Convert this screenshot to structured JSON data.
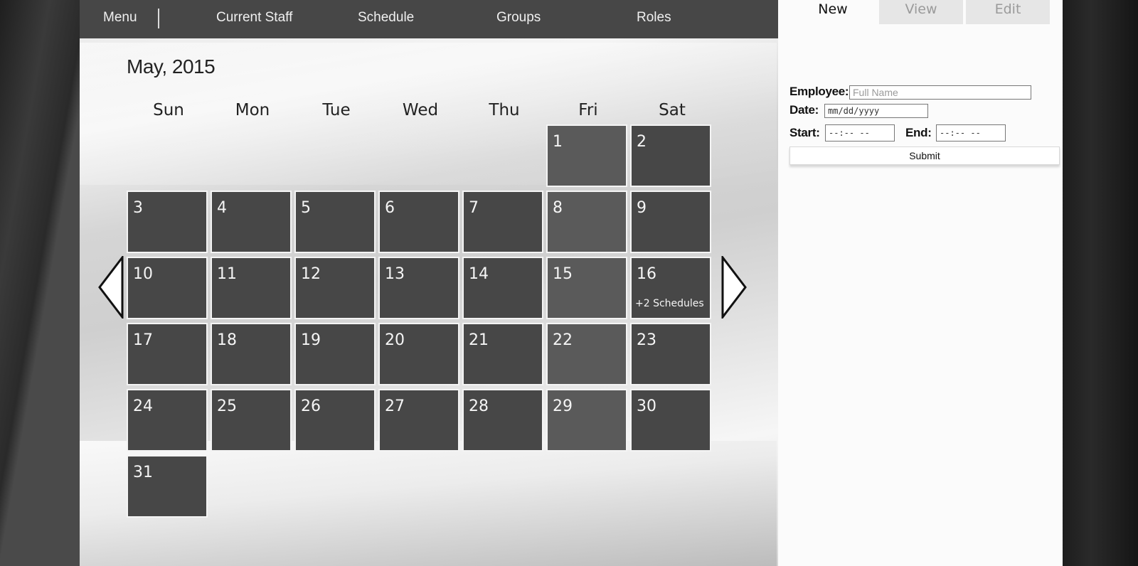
{
  "nav": {
    "menu": "Menu",
    "items": [
      "Current Staff",
      "Schedule",
      "Groups",
      "Roles"
    ]
  },
  "calendar": {
    "month_title": "May, 2015",
    "weekdays": [
      "Sun",
      "Mon",
      "Tue",
      "Wed",
      "Thu",
      "Fri",
      "Sat"
    ],
    "first_weekday_index": 5,
    "days_in_month": 31,
    "events": {
      "16": "+2 Schedules"
    }
  },
  "panel": {
    "tabs": [
      "New",
      "View",
      "Edit"
    ],
    "active_tab": "New",
    "form": {
      "employee_label": "Employee:",
      "employee_placeholder": "Full Name",
      "date_label": "Date:",
      "date_value": "mm/dd/yyyy",
      "start_label": "Start:",
      "start_value": "--:-- --",
      "end_label": "End:",
      "end_value": "--:-- --",
      "submit_label": "Submit"
    }
  },
  "icons": {
    "prev": "triangle-left-icon",
    "next": "triangle-right-icon"
  }
}
